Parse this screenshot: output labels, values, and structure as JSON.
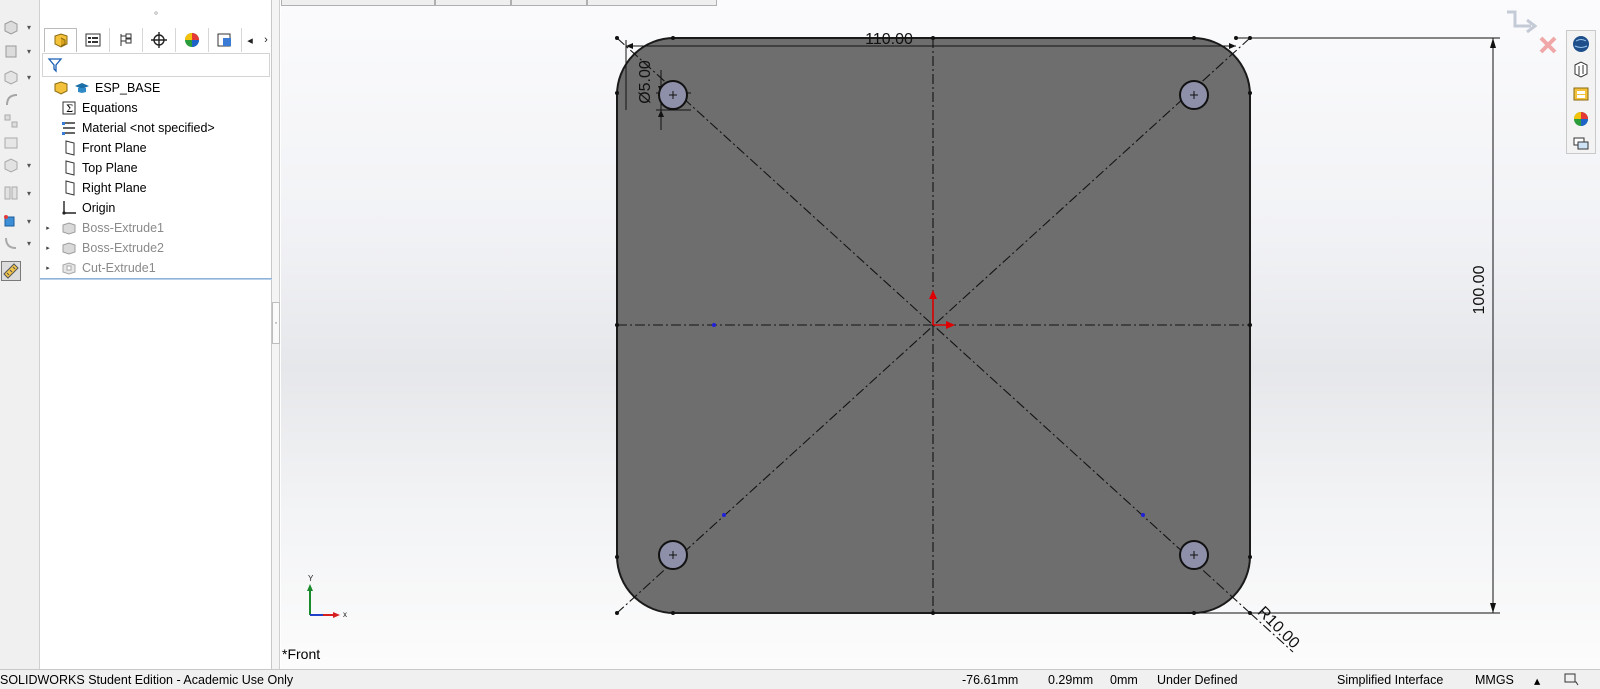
{
  "tree_tabs": [
    {
      "name": "featuremanager",
      "icon": "feature-manager-icon"
    },
    {
      "name": "propertymanager",
      "icon": "property-manager-icon"
    },
    {
      "name": "configurationmanager",
      "icon": "configuration-manager-icon"
    },
    {
      "name": "dimxpertmanager",
      "icon": "dimxpert-icon"
    },
    {
      "name": "displaymanager",
      "icon": "display-manager-icon"
    },
    {
      "name": "cam",
      "icon": "cam-icon"
    }
  ],
  "tree": [
    {
      "label": "ESP_BASE",
      "icon": "part-icon",
      "expander": "",
      "dim": false
    },
    {
      "label": "Equations",
      "icon": "equations-icon",
      "expander": "",
      "dim": false
    },
    {
      "label": "Material <not specified>",
      "icon": "material-icon",
      "expander": "",
      "dim": false
    },
    {
      "label": "Front Plane",
      "icon": "plane-icon",
      "expander": "",
      "dim": false
    },
    {
      "label": "Top Plane",
      "icon": "plane-icon",
      "expander": "",
      "dim": false
    },
    {
      "label": "Right Plane",
      "icon": "plane-icon",
      "expander": "",
      "dim": false
    },
    {
      "label": "Origin",
      "icon": "origin-icon",
      "expander": "",
      "dim": false
    },
    {
      "label": "Boss-Extrude1",
      "icon": "extrude-icon",
      "expander": "▸",
      "dim": true
    },
    {
      "label": "Boss-Extrude2",
      "icon": "extrude-icon",
      "expander": "▸",
      "dim": true
    },
    {
      "label": "Cut-Extrude1",
      "icon": "cut-extrude-icon",
      "expander": "▸",
      "dim": true
    }
  ],
  "viewport": {
    "view_name": "*Front",
    "dimensions": {
      "width": "110.00",
      "height": "100.00",
      "hole_diameter": "Ø5.00",
      "corner_radius": "R10.00"
    },
    "triad": {
      "x_label": "x",
      "y_label": "Y"
    }
  },
  "status": {
    "edition": "SOLIDWORKS Student Edition - Academic Use Only",
    "coord_x": "-76.61mm",
    "coord_y": "0.29mm",
    "coord_z": "0mm",
    "sketch_state": "Under Defined",
    "interface": "Simplified Interface",
    "units": "MMGS",
    "units_arrow": "▴"
  },
  "colors": {
    "part_fill": "#6e6e6e",
    "part_edge": "#1a1a1a",
    "hole_fill": "#8e8fa8",
    "origin_red": "#e00000",
    "sketch_point_blue": "#2121d8",
    "tree_separator": "#8fb2d9"
  }
}
